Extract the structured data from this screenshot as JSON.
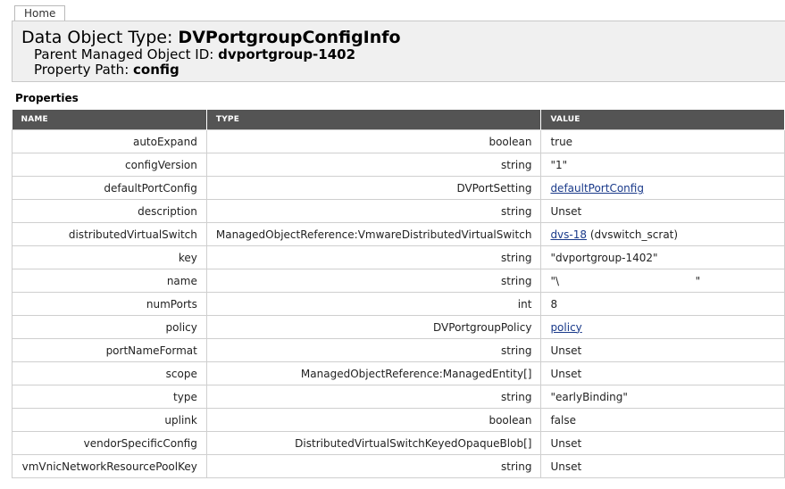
{
  "nav": {
    "home_label": "Home"
  },
  "header": {
    "title_prefix": "Data Object Type: ",
    "title_value": "DVPortgroupConfigInfo",
    "parent_prefix": "Parent Managed Object ID: ",
    "parent_value": "dvportgroup-1402",
    "path_prefix": "Property Path: ",
    "path_value": "config"
  },
  "properties": {
    "heading": "Properties",
    "columns": [
      "NAME",
      "TYPE",
      "VALUE"
    ],
    "rows": [
      {
        "name": "autoExpand",
        "type": "boolean",
        "value": "true"
      },
      {
        "name": "configVersion",
        "type": "string",
        "value": "\"1\""
      },
      {
        "name": "defaultPortConfig",
        "type": "DVPortSetting",
        "value": "defaultPortConfig",
        "is_link": true
      },
      {
        "name": "description",
        "type": "string",
        "value": "Unset"
      },
      {
        "name": "distributedVirtualSwitch",
        "type": "ManagedObjectReference:VmwareDistributedVirtualSwitch",
        "value": "dvs-18",
        "is_link": true,
        "suffix": " (dvswitch_scrat)"
      },
      {
        "name": "key",
        "type": "string",
        "value": "\"dvportgroup-1402\""
      },
      {
        "name": "name",
        "type": "string",
        "value": "\"\\                                        \""
      },
      {
        "name": "numPorts",
        "type": "int",
        "value": "8"
      },
      {
        "name": "policy",
        "type": "DVPortgroupPolicy",
        "value": "policy",
        "is_link": true
      },
      {
        "name": "portNameFormat",
        "type": "string",
        "value": "Unset"
      },
      {
        "name": "scope",
        "type": "ManagedObjectReference:ManagedEntity[]",
        "value": "Unset"
      },
      {
        "name": "type",
        "type": "string",
        "value": "\"earlyBinding\""
      },
      {
        "name": "uplink",
        "type": "boolean",
        "value": "false"
      },
      {
        "name": "vendorSpecificConfig",
        "type": "DistributedVirtualSwitchKeyedOpaqueBlob[]",
        "value": "Unset"
      },
      {
        "name": "vmVnicNetworkResourcePoolKey",
        "type": "string",
        "value": "Unset"
      }
    ]
  },
  "colors": {
    "header_bg": "#f0f0f0",
    "table_head_bg": "#545454",
    "link": "#1a3a8a"
  }
}
